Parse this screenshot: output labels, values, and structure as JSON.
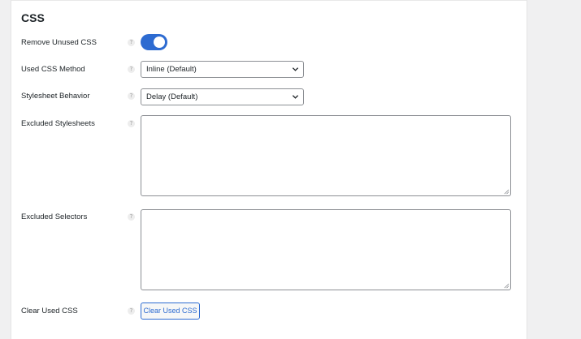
{
  "section": {
    "title": "CSS"
  },
  "rows": {
    "remove_unused": {
      "label": "Remove Unused CSS",
      "help": "?",
      "enabled": true
    },
    "method": {
      "label": "Used CSS Method",
      "help": "?",
      "value": "Inline (Default)"
    },
    "stylesheet_behavior": {
      "label": "Stylesheet Behavior",
      "help": "?",
      "value": "Delay (Default)"
    },
    "excluded_stylesheets": {
      "label": "Excluded Stylesheets",
      "help": "?",
      "value": ""
    },
    "excluded_selectors": {
      "label": "Excluded Selectors",
      "help": "?",
      "value": ""
    },
    "clear": {
      "label": "Clear Used CSS",
      "help": "?",
      "button_label": "Clear Used CSS"
    }
  },
  "colors": {
    "accent": "#2d6bd1",
    "border": "#8c8f94",
    "background": "#f0f0f1"
  },
  "icons": {
    "help": "question-mark-icon",
    "dropdown": "chevron-down-icon"
  }
}
